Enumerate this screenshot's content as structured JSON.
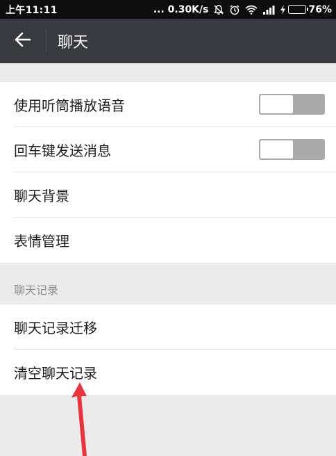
{
  "status_bar": {
    "time": "上午11:11",
    "network_speed": "... 0.30K/s",
    "battery_percent": "76%",
    "battery_level": 0.76,
    "icons": [
      "bell-off-icon",
      "alarm-icon",
      "wifi-icon",
      "signal-icon",
      "charging-icon",
      "battery-icon"
    ]
  },
  "header": {
    "back_icon": "arrow-left-icon",
    "title": "聊天",
    "background": "#393a3f"
  },
  "settings": {
    "items": [
      {
        "label": "使用听筒播放语音",
        "toggle": true,
        "on": false
      },
      {
        "label": "回车键发送消息",
        "toggle": true,
        "on": false
      },
      {
        "label": "聊天背景",
        "toggle": false
      },
      {
        "label": "表情管理",
        "toggle": false
      }
    ]
  },
  "chat_records": {
    "header": "聊天记录",
    "items": [
      {
        "label": "聊天记录迁移"
      },
      {
        "label": "清空聊天记录"
      }
    ]
  },
  "annotation": {
    "type": "red-arrow",
    "color": "#e8343e",
    "points_to": "清空聊天记录"
  }
}
